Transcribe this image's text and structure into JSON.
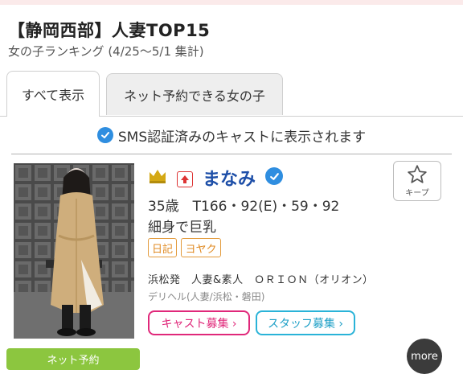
{
  "header": {
    "title": "【静岡西部】人妻TOP15",
    "subtitle": "女の子ランキング (4/25〜5/1 集計)"
  },
  "tabs": [
    {
      "label": "すべて表示",
      "active": true
    },
    {
      "label": "ネット予約できる女の子",
      "active": false
    }
  ],
  "sms_note": "SMS認証済みのキャストに表示されます",
  "cast": {
    "name": "まなみ",
    "profile": "35歳　T166・92(E)・59・92",
    "catch_copy": "細身で巨乳",
    "tags": [
      "日記",
      "ヨヤク"
    ],
    "shop": "浜松発　人妻&素人　ＯＲＩＯＮ（オリオン）",
    "genre": "デリヘル(人妻/浜松・磐田)",
    "keep_label": "キープ",
    "cast_recruit_label": "キャスト募集 ›",
    "staff_recruit_label": "スタッフ募集 ›",
    "net_reserve_label": "ネット予約"
  },
  "more_label": "more",
  "icons": {
    "verified": "verified-check-icon",
    "crown": "crown-icon",
    "rank_up": "rank-up-arrow-icon",
    "keep": "star-outline-icon"
  },
  "colors": {
    "name": "#1e4fa8",
    "verified": "#2f8ee0",
    "tag": "#e08a22",
    "cast_recruit": "#e0287a",
    "staff_recruit": "#2ab3d8",
    "net_reserve": "#8cc63f",
    "crown": "#d4a814"
  }
}
